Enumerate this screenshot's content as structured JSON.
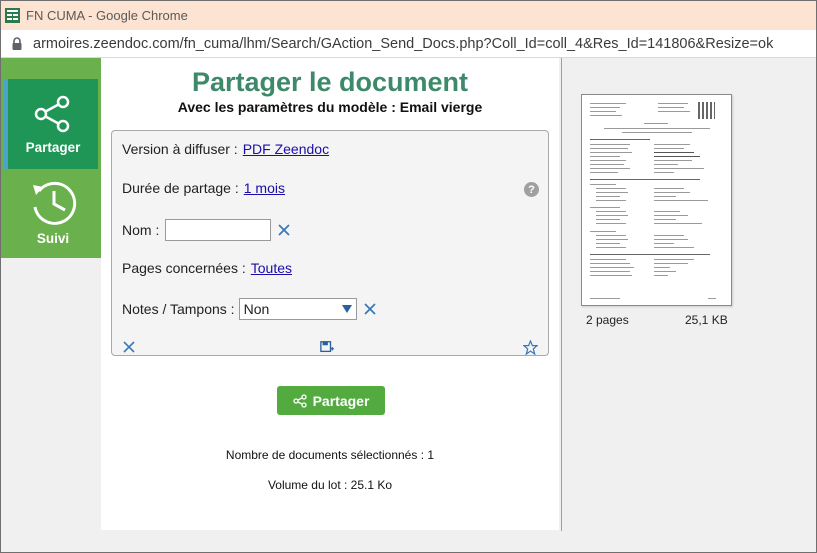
{
  "browser": {
    "window_title": "FN CUMA - Google Chrome",
    "url": "armoires.zeendoc.com/fn_cuma/lhm/Search/GAction_Send_Docs.php?Coll_Id=coll_4&Res_Id=141806&Resize=ok"
  },
  "sidebar": {
    "items": [
      {
        "label": "Partager",
        "icon": "share-icon",
        "active": true
      },
      {
        "label": "Suivi",
        "icon": "history-clock-icon",
        "active": false
      }
    ]
  },
  "main": {
    "title": "Partager le document",
    "subtitle": "Avec les paramètres du modèle : Email vierge",
    "form": {
      "version_label": "Version à diffuser :",
      "version_value": "PDF Zeendoc",
      "duration_label": "Durée de partage :",
      "duration_value": "1 mois",
      "name_label": "Nom :",
      "name_value": "",
      "pages_label": "Pages concernées :",
      "pages_value": "Toutes",
      "notes_label": "Notes / Tampons :",
      "notes_value": "Non"
    },
    "share_button_label": "Partager",
    "selected_count_label": "Nombre de documents sélectionnés :",
    "selected_count_value": "1",
    "volume_label": "Volume du lot :",
    "volume_value": "25.1 Ko"
  },
  "preview": {
    "pages": "2 pages",
    "size": "25,1 KB"
  },
  "colors": {
    "title_green": "#3d8a6a",
    "sidebar_green": "#6ab04c",
    "active_green": "#1f9656",
    "button_green": "#53ab3f",
    "link_blue": "#1a0dab",
    "icon_blue": "#3a78b8"
  }
}
